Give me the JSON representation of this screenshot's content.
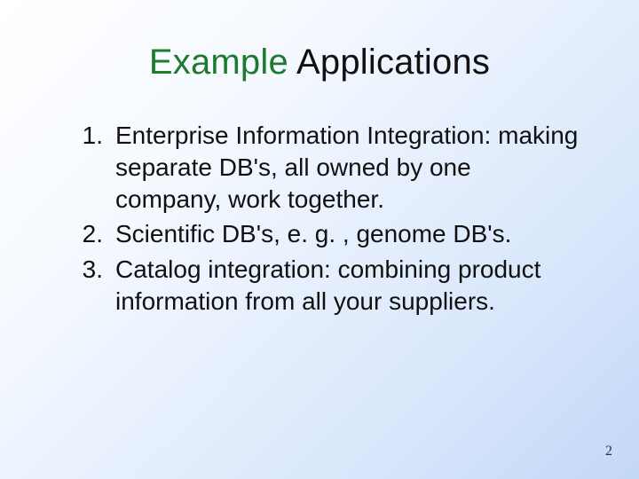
{
  "title": {
    "word1": "Example",
    "word2": "Applications"
  },
  "items": [
    {
      "num": "1.",
      "text": "Enterprise Information Integration: making separate DB's, all owned by one company, work together."
    },
    {
      "num": "2.",
      "text": "Scientific DB's, e. g. , genome DB's."
    },
    {
      "num": "3.",
      "text": "Catalog integration: combining product information from all your suppliers."
    }
  ],
  "page_number": "2"
}
